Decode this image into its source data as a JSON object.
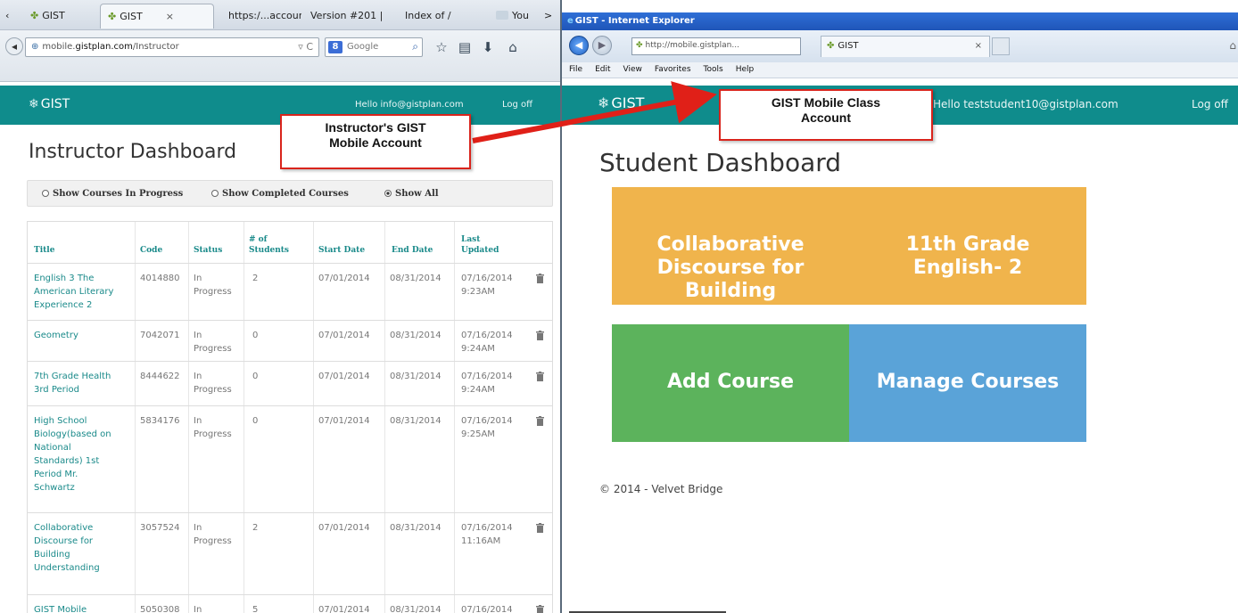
{
  "firefox": {
    "tabs": [
      {
        "label": "GIST",
        "icon": "gist-leaf-icon"
      },
      {
        "label": "GIST",
        "icon": "gist-leaf-icon",
        "close": "×"
      },
      {
        "label": "https:/...account"
      },
      {
        "label": "Version #201 |..."
      },
      {
        "label": "Index of /"
      },
      {
        "label": "You",
        "icon": "video-icon"
      }
    ],
    "tab_scroll_right": ">",
    "url_prefix": "mobile.",
    "url_domain": "gistplan.com",
    "url_path": "/Instructor",
    "url_tools": "▿ C",
    "search_engine": "8",
    "search_placeholder": "Google",
    "header_logo": "GIST",
    "greeting": "Hello info@gistplan.com",
    "logoff": "Log off",
    "page_title": "Instructor Dashboard",
    "filters": [
      {
        "label": "Show Courses In Progress",
        "selected": false
      },
      {
        "label": "Show Completed Courses",
        "selected": false
      },
      {
        "label": "Show All",
        "selected": true
      }
    ],
    "table": {
      "headers": {
        "title": "Title",
        "code": "Code",
        "status": "Status",
        "students": "# of\nStudents",
        "start": "Start Date",
        "end": "End Date",
        "updated": "Last\nUpdated"
      },
      "rows": [
        {
          "title": "English 3 The\nAmerican Literary\nExperience 2",
          "code": "4014880",
          "status": "In\nProgress",
          "students": "2",
          "start": "07/01/2014",
          "end": "08/31/2014",
          "updated": "07/16/2014\n9:23AM"
        },
        {
          "title": "Geometry",
          "code": "7042071",
          "status": "In\nProgress",
          "students": "0",
          "start": "07/01/2014",
          "end": "08/31/2014",
          "updated": "07/16/2014\n9:24AM"
        },
        {
          "title": "7th Grade Health\n3rd Period",
          "code": "8444622",
          "status": "In\nProgress",
          "students": "0",
          "start": "07/01/2014",
          "end": "08/31/2014",
          "updated": "07/16/2014\n9:24AM"
        },
        {
          "title": "High School\nBiology(based on\nNational\nStandards) 1st\nPeriod Mr.\nSchwartz",
          "code": "5834176",
          "status": "In\nProgress",
          "students": "0",
          "start": "07/01/2014",
          "end": "08/31/2014",
          "updated": "07/16/2014\n9:25AM"
        },
        {
          "title": "Collaborative\nDiscourse for\nBuilding\nUnderstanding",
          "code": "3057524",
          "status": "In\nProgress",
          "students": "2",
          "start": "07/01/2014",
          "end": "08/31/2014",
          "updated": "07/16/2014\n11:16AM"
        },
        {
          "title": "GIST Mobile",
          "code": "5050308",
          "status": "In",
          "students": "5",
          "start": "07/01/2014",
          "end": "08/31/2014",
          "updated": "07/16/2014"
        }
      ]
    }
  },
  "ie": {
    "window_title": "GIST - Internet Explorer",
    "address": "http://mobile.gistplan...",
    "tab_label": "GIST",
    "tab_close": "×",
    "menu": [
      "File",
      "Edit",
      "View",
      "Favorites",
      "Tools",
      "Help"
    ],
    "header_logo": "GIST",
    "greeting": "Hello teststudent10@gistplan.com",
    "logoff": "Log off",
    "page_title": "Student Dashboard",
    "tiles": [
      {
        "lines": [
          "Collaborative",
          "Discourse for",
          "Building"
        ],
        "color": "#f0b44c"
      },
      {
        "lines": [
          "11th Grade",
          "English- 2"
        ],
        "color": "#f0b44c"
      },
      {
        "lines": [
          "Add Course"
        ],
        "color": "#5cb35c"
      },
      {
        "lines": [
          "Manage Courses"
        ],
        "color": "#5aa3d8"
      }
    ],
    "footer": "© 2014 - Velvet Bridge"
  },
  "annotations": {
    "instructor_callout": "Instructor's GIST\nMobile Account",
    "student_callout": "GIST Mobile Class\nAccount",
    "arrow_color": "#e02018"
  }
}
